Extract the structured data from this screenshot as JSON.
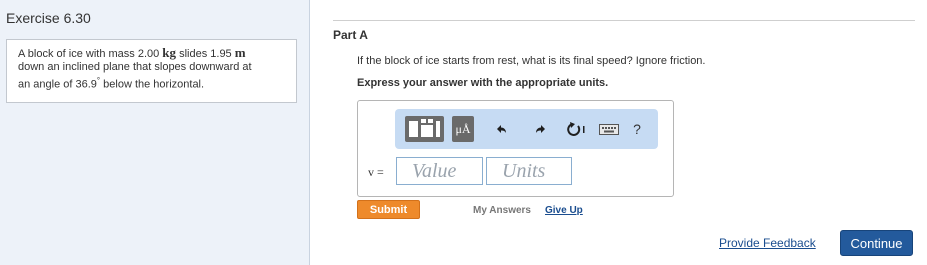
{
  "exercise": {
    "title": "Exercise 6.30"
  },
  "problem": {
    "t1": "A block of ice with mass 2.00 ",
    "u1": "kg",
    "t2": " slides 1.95 ",
    "u2": "m",
    "t3": "down an inclined plane that slopes downward at",
    "t4": "an angle of 36.9",
    "deg": "°",
    "t5": " below the horizontal."
  },
  "part": {
    "title": "Part A",
    "question": "If the block of ice starts from rest, what is its final speed? Ignore friction.",
    "instruction": "Express your answer with the appropriate units."
  },
  "toolbar": {
    "units_label": "μÅ",
    "help_label": "?",
    "icons": [
      "templates-icon",
      "units-icon",
      "undo-icon",
      "redo-icon",
      "reset-icon",
      "keyboard-icon",
      "help-icon"
    ]
  },
  "answer": {
    "variable": "v =",
    "value_placeholder": "Value",
    "units_placeholder": "Units"
  },
  "actions": {
    "submit": "Submit",
    "my_answers": "My Answers",
    "give_up": "Give Up",
    "feedback": "Provide Feedback",
    "continue": "Continue"
  },
  "colors": {
    "left_panel_bg": "#edf2f9",
    "toolbar_bg": "#c6dbf3",
    "submit_bg": "#ee8a2b",
    "continue_bg": "#235a9c",
    "link": "#1a4d8f"
  }
}
